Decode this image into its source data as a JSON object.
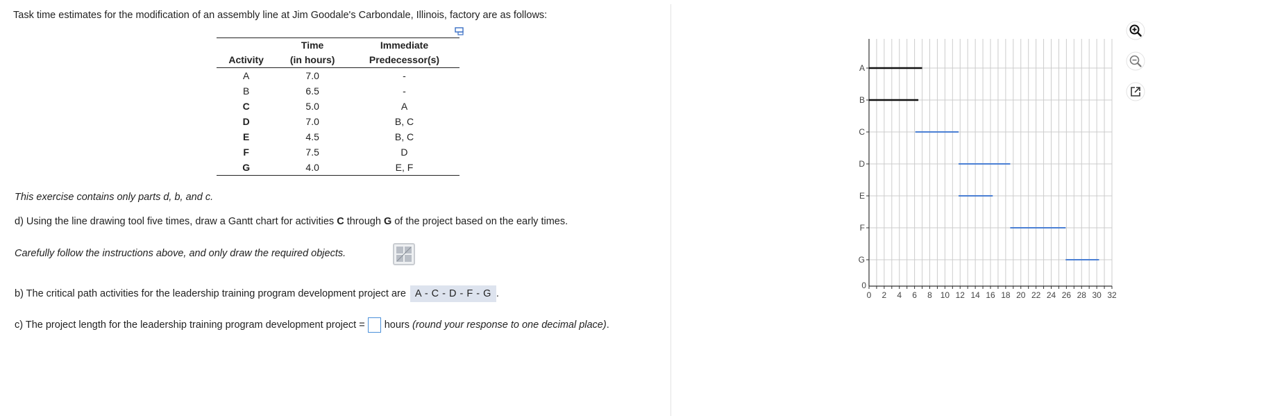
{
  "intro": "Task time estimates for the modification of an assembly line at Jim Goodale's Carbondale, Illinois, factory are as follows:",
  "table": {
    "headers": {
      "activity": "Activity",
      "time_line1": "Time",
      "time_line2": "(in hours)",
      "pred_line1": "Immediate",
      "pred_line2": "Predecessor(s)"
    },
    "rows": [
      {
        "activity": "A",
        "time": "7.0",
        "pred": "-",
        "bold": false
      },
      {
        "activity": "B",
        "time": "6.5",
        "pred": "-",
        "bold": false
      },
      {
        "activity": "C",
        "time": "5.0",
        "pred": "A",
        "bold": true
      },
      {
        "activity": "D",
        "time": "7.0",
        "pred": "B, C",
        "bold": true
      },
      {
        "activity": "E",
        "time": "4.5",
        "pred": "B, C",
        "bold": true
      },
      {
        "activity": "F",
        "time": "7.5",
        "pred": "D",
        "bold": true
      },
      {
        "activity": "G",
        "time": "4.0",
        "pred": "E, F",
        "bold": true
      }
    ]
  },
  "note": "This exercise contains only parts d, b, and c.",
  "part_d": {
    "prefix": "d) Using the line drawing tool five times, draw a Gantt chart for activities ",
    "bold1": "C",
    "middle": " through ",
    "bold2": "G",
    "suffix": " of the project based on the early times."
  },
  "follow": "Carefully follow the instructions above, and only draw the required objects.",
  "part_b": {
    "text": "b) The critical path activities for the leadership training program development project are",
    "answer": "A - C - D - F - G",
    "end": "."
  },
  "part_c": {
    "text": "c) The project length for the leadership training program development project =",
    "input_value": "",
    "after": "hours",
    "italic": "(round your response to one decimal place)",
    "end": "."
  },
  "icons": {
    "copy": "copy-icon",
    "zoom_in": "zoom-in-icon",
    "zoom_out": "zoom-out-icon",
    "popout": "popout-icon",
    "line_tool": "line-tool-icon"
  },
  "colors": {
    "given_bar": "#111111",
    "drawn_bar": "#4a7fd4",
    "grid": "#cccccc"
  },
  "chart_data": {
    "type": "gantt",
    "rows": [
      "A",
      "B",
      "C",
      "D",
      "E",
      "F",
      "G"
    ],
    "x_ticks": [
      0,
      2,
      4,
      6,
      8,
      10,
      12,
      14,
      16,
      18,
      20,
      22,
      24,
      26,
      28,
      30,
      32
    ],
    "x_origin_label": "0",
    "xlim": [
      0,
      32
    ],
    "grid": true,
    "bars": [
      {
        "row": "A",
        "start": 0,
        "end": 7.0,
        "style": "given"
      },
      {
        "row": "B",
        "start": 0,
        "end": 6.5,
        "style": "given"
      },
      {
        "row": "C",
        "start": 6.1,
        "end": 11.8,
        "style": "drawn"
      },
      {
        "row": "D",
        "start": 11.8,
        "end": 18.6,
        "style": "drawn"
      },
      {
        "row": "E",
        "start": 11.8,
        "end": 16.3,
        "style": "drawn"
      },
      {
        "row": "F",
        "start": 18.6,
        "end": 25.9,
        "style": "drawn"
      },
      {
        "row": "G",
        "start": 25.9,
        "end": 30.3,
        "style": "drawn"
      }
    ]
  }
}
